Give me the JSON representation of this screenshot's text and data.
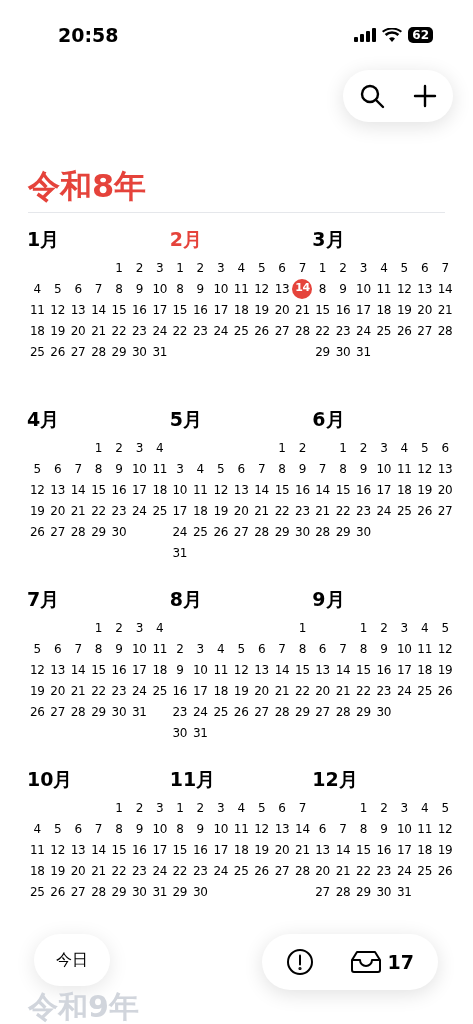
{
  "status_bar": {
    "time": "20:58",
    "battery": "62"
  },
  "year_title": "令和8年",
  "months": [
    {
      "name": "1月",
      "selected": false,
      "weeks": [
        [
          "1",
          "2",
          "3"
        ],
        [
          "4",
          "5",
          "6",
          "7",
          "8",
          "9",
          "10"
        ],
        [
          "11",
          "12",
          "13",
          "14",
          "15",
          "16",
          "17"
        ],
        [
          "18",
          "19",
          "20",
          "21",
          "22",
          "23",
          "24"
        ],
        [
          "25",
          "26",
          "27",
          "28",
          "29",
          "30",
          "31"
        ]
      ]
    },
    {
      "name": "2月",
      "selected": true,
      "weeks": [
        [
          "1",
          "2",
          "3",
          "4",
          "5",
          "6",
          "7"
        ],
        [
          "8",
          "9",
          "10",
          "11",
          "12",
          "13",
          {
            "text": "14",
            "today": true
          }
        ],
        [
          "15",
          "16",
          "17",
          "18",
          "19",
          "20",
          "21"
        ],
        [
          "22",
          "23",
          "24",
          "25",
          "26",
          "27",
          "28"
        ]
      ]
    },
    {
      "name": "3月",
      "selected": false,
      "weeks": [
        [
          "1",
          "2",
          "3",
          "4",
          "5",
          "6",
          "7"
        ],
        [
          "8",
          "9",
          "10",
          "11",
          "12",
          "13",
          "14"
        ],
        [
          "15",
          "16",
          "17",
          "18",
          "19",
          "20",
          "21"
        ],
        [
          "22",
          "23",
          "24",
          "25",
          "26",
          "27",
          "28"
        ],
        [
          "29",
          "30",
          "31"
        ]
      ]
    },
    {
      "name": "4月",
      "selected": false,
      "weeks": [
        [
          "1",
          "2",
          "3",
          "4"
        ],
        [
          "5",
          "6",
          "7",
          "8",
          "9",
          "10",
          "11"
        ],
        [
          "12",
          "13",
          "14",
          "15",
          "16",
          "17",
          "18"
        ],
        [
          "19",
          "20",
          "21",
          "22",
          "23",
          "24",
          "25"
        ],
        [
          "26",
          "27",
          "28",
          "29",
          "30"
        ]
      ]
    },
    {
      "name": "5月",
      "selected": false,
      "weeks": [
        [
          "1",
          "2"
        ],
        [
          "3",
          "4",
          "5",
          "6",
          "7",
          "8",
          "9"
        ],
        [
          "10",
          "11",
          "12",
          "13",
          "14",
          "15",
          "16"
        ],
        [
          "17",
          "18",
          "19",
          "20",
          "21",
          "22",
          "23"
        ],
        [
          "24",
          "25",
          "26",
          "27",
          "28",
          "29",
          "30"
        ],
        [
          "31"
        ]
      ]
    },
    {
      "name": "6月",
      "selected": false,
      "weeks": [
        [
          "1",
          "2",
          "3",
          "4",
          "5",
          "6"
        ],
        [
          "7",
          "8",
          "9",
          "10",
          "11",
          "12",
          "13"
        ],
        [
          "14",
          "15",
          "16",
          "17",
          "18",
          "19",
          "20"
        ],
        [
          "21",
          "22",
          "23",
          "24",
          "25",
          "26",
          "27"
        ],
        [
          "28",
          "29",
          "30"
        ]
      ]
    },
    {
      "name": "7月",
      "selected": false,
      "weeks": [
        [
          "1",
          "2",
          "3",
          "4"
        ],
        [
          "5",
          "6",
          "7",
          "8",
          "9",
          "10",
          "11"
        ],
        [
          "12",
          "13",
          "14",
          "15",
          "16",
          "17",
          "18"
        ],
        [
          "19",
          "20",
          "21",
          "22",
          "23",
          "24",
          "25"
        ],
        [
          "26",
          "27",
          "28",
          "29",
          "30",
          "31"
        ]
      ]
    },
    {
      "name": "8月",
      "selected": false,
      "weeks": [
        [
          "1"
        ],
        [
          "2",
          "3",
          "4",
          "5",
          "6",
          "7",
          "8"
        ],
        [
          "9",
          "10",
          "11",
          "12",
          "13",
          "14",
          "15"
        ],
        [
          "16",
          "17",
          "18",
          "19",
          "20",
          "21",
          "22"
        ],
        [
          "23",
          "24",
          "25",
          "26",
          "27",
          "28",
          "29"
        ],
        [
          "30",
          "31"
        ]
      ]
    },
    {
      "name": "9月",
      "selected": false,
      "weeks": [
        [
          "1",
          "2",
          "3",
          "4",
          "5"
        ],
        [
          "6",
          "7",
          "8",
          "9",
          "10",
          "11",
          "12"
        ],
        [
          "13",
          "14",
          "15",
          "16",
          "17",
          "18",
          "19"
        ],
        [
          "20",
          "21",
          "22",
          "23",
          "24",
          "25",
          "26"
        ],
        [
          "27",
          "28",
          "29",
          "30"
        ]
      ]
    },
    {
      "name": "10月",
      "selected": false,
      "weeks": [
        [
          "1",
          "2",
          "3"
        ],
        [
          "4",
          "5",
          "6",
          "7",
          "8",
          "9",
          "10"
        ],
        [
          "11",
          "12",
          "13",
          "14",
          "15",
          "16",
          "17"
        ],
        [
          "18",
          "19",
          "20",
          "21",
          "22",
          "23",
          "24"
        ],
        [
          "25",
          "26",
          "27",
          "28",
          "29",
          "30",
          "31"
        ]
      ]
    },
    {
      "name": "11月",
      "selected": false,
      "weeks": [
        [
          "1",
          "2",
          "3",
          "4",
          "5",
          "6",
          "7"
        ],
        [
          "8",
          "9",
          "10",
          "11",
          "12",
          "13",
          "14"
        ],
        [
          "15",
          "16",
          "17",
          "18",
          "19",
          "20",
          "21"
        ],
        [
          "22",
          "23",
          "24",
          "25",
          "26",
          "27",
          "28"
        ],
        [
          "29",
          "30"
        ]
      ]
    },
    {
      "name": "12月",
      "selected": false,
      "weeks": [
        [
          "1",
          "2",
          "3",
          "4",
          "5"
        ],
        [
          "6",
          "7",
          "8",
          "9",
          "10",
          "11",
          "12"
        ],
        [
          "13",
          "14",
          "15",
          "16",
          "17",
          "18",
          "19"
        ],
        [
          "20",
          "21",
          "22",
          "23",
          "24",
          "25",
          "26"
        ],
        [
          "27",
          "28",
          "29",
          "30",
          "31"
        ]
      ]
    }
  ],
  "bottom_bar": {
    "today_button": "今日",
    "inbox_count": "17"
  },
  "next_year_title": "令和9年"
}
